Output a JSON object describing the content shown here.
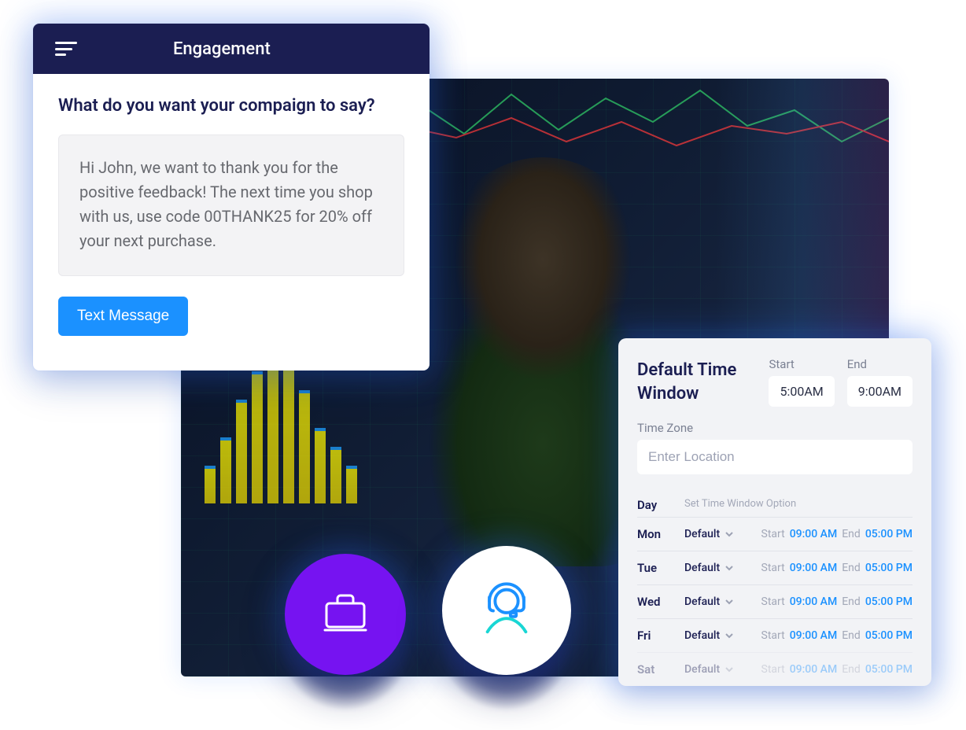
{
  "engagement": {
    "title": "Engagement",
    "question": "What do you want your compaign to say?",
    "message_body": "Hi John, we want to thank you for the positive feedback! The next time you shop with us, use code 00THANK25 for 20% off your next purchase.",
    "button_label": "Text Message"
  },
  "icons": {
    "briefcase_name": "briefcase-icon",
    "support_name": "support-icon"
  },
  "time_window": {
    "title": "Default Time Window",
    "start_label": "Start",
    "end_label": "End",
    "start_value": "5:00AM",
    "end_value": "9:00AM",
    "timezone_label": "Time Zone",
    "timezone_placeholder": "Enter Location",
    "table": {
      "header_day": "Day",
      "header_option": "Set Time Window Option",
      "start_label": "Start",
      "end_label": "End",
      "rows": [
        {
          "day": "Mon",
          "option": "Default",
          "start": "09:00 AM",
          "end": "05:00 PM"
        },
        {
          "day": "Tue",
          "option": "Default",
          "start": "09:00 AM",
          "end": "05:00 PM"
        },
        {
          "day": "Wed",
          "option": "Default",
          "start": "09:00 AM",
          "end": "05:00 PM"
        },
        {
          "day": "Fri",
          "option": "Default",
          "start": "09:00 AM",
          "end": "05:00 PM"
        },
        {
          "day": "Sat",
          "option": "Default",
          "start": "09:00 AM",
          "end": "05:00 PM"
        }
      ]
    }
  },
  "colors": {
    "brand_navy": "#1b1e52",
    "brand_blue": "#1b91ff",
    "brand_purple": "#7613f1",
    "glow_blue": "#2b71ff"
  }
}
